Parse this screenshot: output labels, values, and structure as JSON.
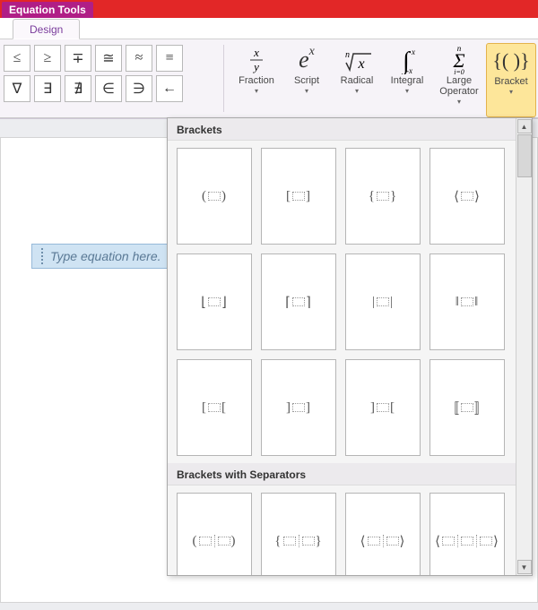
{
  "titlebar": {
    "context_label": "Equation Tools"
  },
  "tabs": {
    "design": "Design"
  },
  "symbols": {
    "row1": [
      "≤",
      "≥",
      "∓",
      "≅",
      "≈",
      "≡"
    ],
    "row2": [
      "∇",
      "∃",
      "∄",
      "∈",
      "∋",
      "←"
    ]
  },
  "structures": {
    "fraction": "Fraction",
    "script": "Script",
    "radical": "Radical",
    "integral": "Integral",
    "large_operator": "Large\nOperator",
    "bracket": "Bracket"
  },
  "equation_placeholder": "Type equation here.",
  "gallery": {
    "section1_title": "Brackets",
    "section2_title": "Brackets with Separators",
    "items1": [
      {
        "left": "(",
        "right": ")",
        "phs": 1,
        "seps": 0
      },
      {
        "left": "[",
        "right": "]",
        "phs": 1,
        "seps": 0
      },
      {
        "left": "{",
        "right": "}",
        "phs": 1,
        "seps": 0
      },
      {
        "left": "⟨",
        "right": "⟩",
        "phs": 1,
        "seps": 0
      },
      {
        "left": "⌊",
        "right": "⌋",
        "phs": 1,
        "seps": 0
      },
      {
        "left": "⌈",
        "right": "⌉",
        "phs": 1,
        "seps": 0
      },
      {
        "left": "|",
        "right": "|",
        "phs": 1,
        "seps": 0
      },
      {
        "left": "‖",
        "right": "‖",
        "phs": 1,
        "seps": 0
      },
      {
        "left": "[",
        "right": "[",
        "phs": 1,
        "seps": 0
      },
      {
        "left": "]",
        "right": "]",
        "phs": 1,
        "seps": 0
      },
      {
        "left": "]",
        "right": "[",
        "phs": 1,
        "seps": 0
      },
      {
        "left": "〚",
        "right": "〛",
        "phs": 1,
        "seps": 0
      }
    ],
    "items2": [
      {
        "left": "(",
        "right": ")",
        "phs": 2,
        "seps": 1
      },
      {
        "left": "{",
        "right": "}",
        "phs": 2,
        "seps": 1
      },
      {
        "left": "⟨",
        "right": "⟩",
        "phs": 2,
        "seps": 1
      },
      {
        "left": "⟨",
        "right": "⟩",
        "phs": 3,
        "seps": 2
      }
    ]
  }
}
